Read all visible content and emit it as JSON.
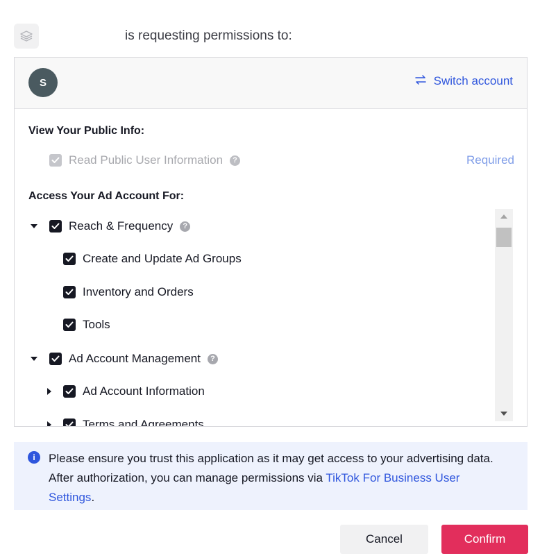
{
  "header": {
    "app_icon": "layers-icon",
    "request_text": "is requesting permissions to:"
  },
  "account": {
    "avatar_letter": "S",
    "switch_label": "Switch account",
    "switch_icon": "swap-arrows-icon"
  },
  "public_info": {
    "title": "View Your Public Info:",
    "item_label": "Read Public User Information",
    "required_label": "Required"
  },
  "ad_account": {
    "title": "Access Your Ad Account For:",
    "groups": [
      {
        "label": "Reach & Frequency",
        "expanded": true,
        "checked": true,
        "children": [
          {
            "label": "Create and Update Ad Groups",
            "checked": true
          },
          {
            "label": "Inventory and Orders",
            "checked": true
          },
          {
            "label": "Tools",
            "checked": true
          }
        ]
      },
      {
        "label": "Ad Account Management",
        "expanded": true,
        "checked": true,
        "children": [
          {
            "label": "Ad Account Information",
            "checked": true,
            "collapsed": true
          },
          {
            "label": "Terms and Agreements",
            "checked": true,
            "collapsed": true
          }
        ]
      }
    ]
  },
  "notice": {
    "text_before": "Please ensure you trust this application as it may get access to your advertising data. After authorization, you can manage permissions via ",
    "link_text": "TikTok For Business User Settings",
    "text_after": "."
  },
  "buttons": {
    "cancel": "Cancel",
    "confirm": "Confirm"
  },
  "colors": {
    "accent": "#2f56dd",
    "confirm": "#e22e5c",
    "notice_bg": "#eef2fd"
  }
}
